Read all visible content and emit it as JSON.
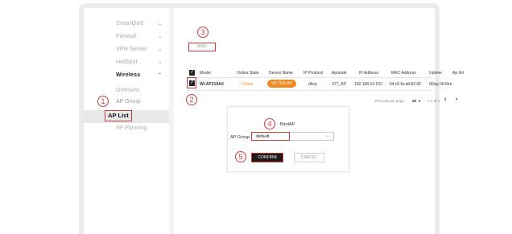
{
  "sidebar": {
    "items": [
      {
        "label": "SmartQoS",
        "chevron": "⌄"
      },
      {
        "label": "Fierwall",
        "chevron": "⌄"
      },
      {
        "label": "VPN Server",
        "chevron": "⌄"
      },
      {
        "label": "HotSpot",
        "chevron": "⌄"
      },
      {
        "label": "Wireless",
        "chevron": "⌃"
      }
    ],
    "sub_items": [
      {
        "label": "Overview"
      },
      {
        "label": "AP Group"
      },
      {
        "label": "AP List"
      },
      {
        "label": "RF Planning"
      }
    ]
  },
  "callouts": [
    "1",
    "2",
    "3",
    "4",
    "5"
  ],
  "toolbar": {
    "bind_label": "BIND"
  },
  "table": {
    "headers": [
      "Model",
      "Online State",
      "Device Name",
      "IP Protocol",
      "Apmode",
      "IP Address",
      "MAC Address",
      "Uptime",
      "Ap Grt"
    ],
    "row": {
      "model": "WI-AP219AX",
      "state": "Online",
      "device_name": "WI-TEA-AP",
      "protocol": "dhcp",
      "apmode": "FIT_AP",
      "ip": "192.168.10.102",
      "mac": "44:d1:fa:a8:82:06",
      "uptime": "0Day 0h16m"
    }
  },
  "pager": {
    "label": "Records per page:",
    "per_page": "20",
    "range": "1~1 of 1",
    "prev": "‹",
    "next": "›"
  },
  "dialog": {
    "title": "BindAP",
    "group_label": "AP Group",
    "group_value": "default",
    "confirm_label": "CONFIRM",
    "cancel_label": "CANCEL"
  },
  "colors": {
    "accent": "#d23a3a",
    "online": "#f39a2b",
    "pill": "#f28a1e"
  }
}
